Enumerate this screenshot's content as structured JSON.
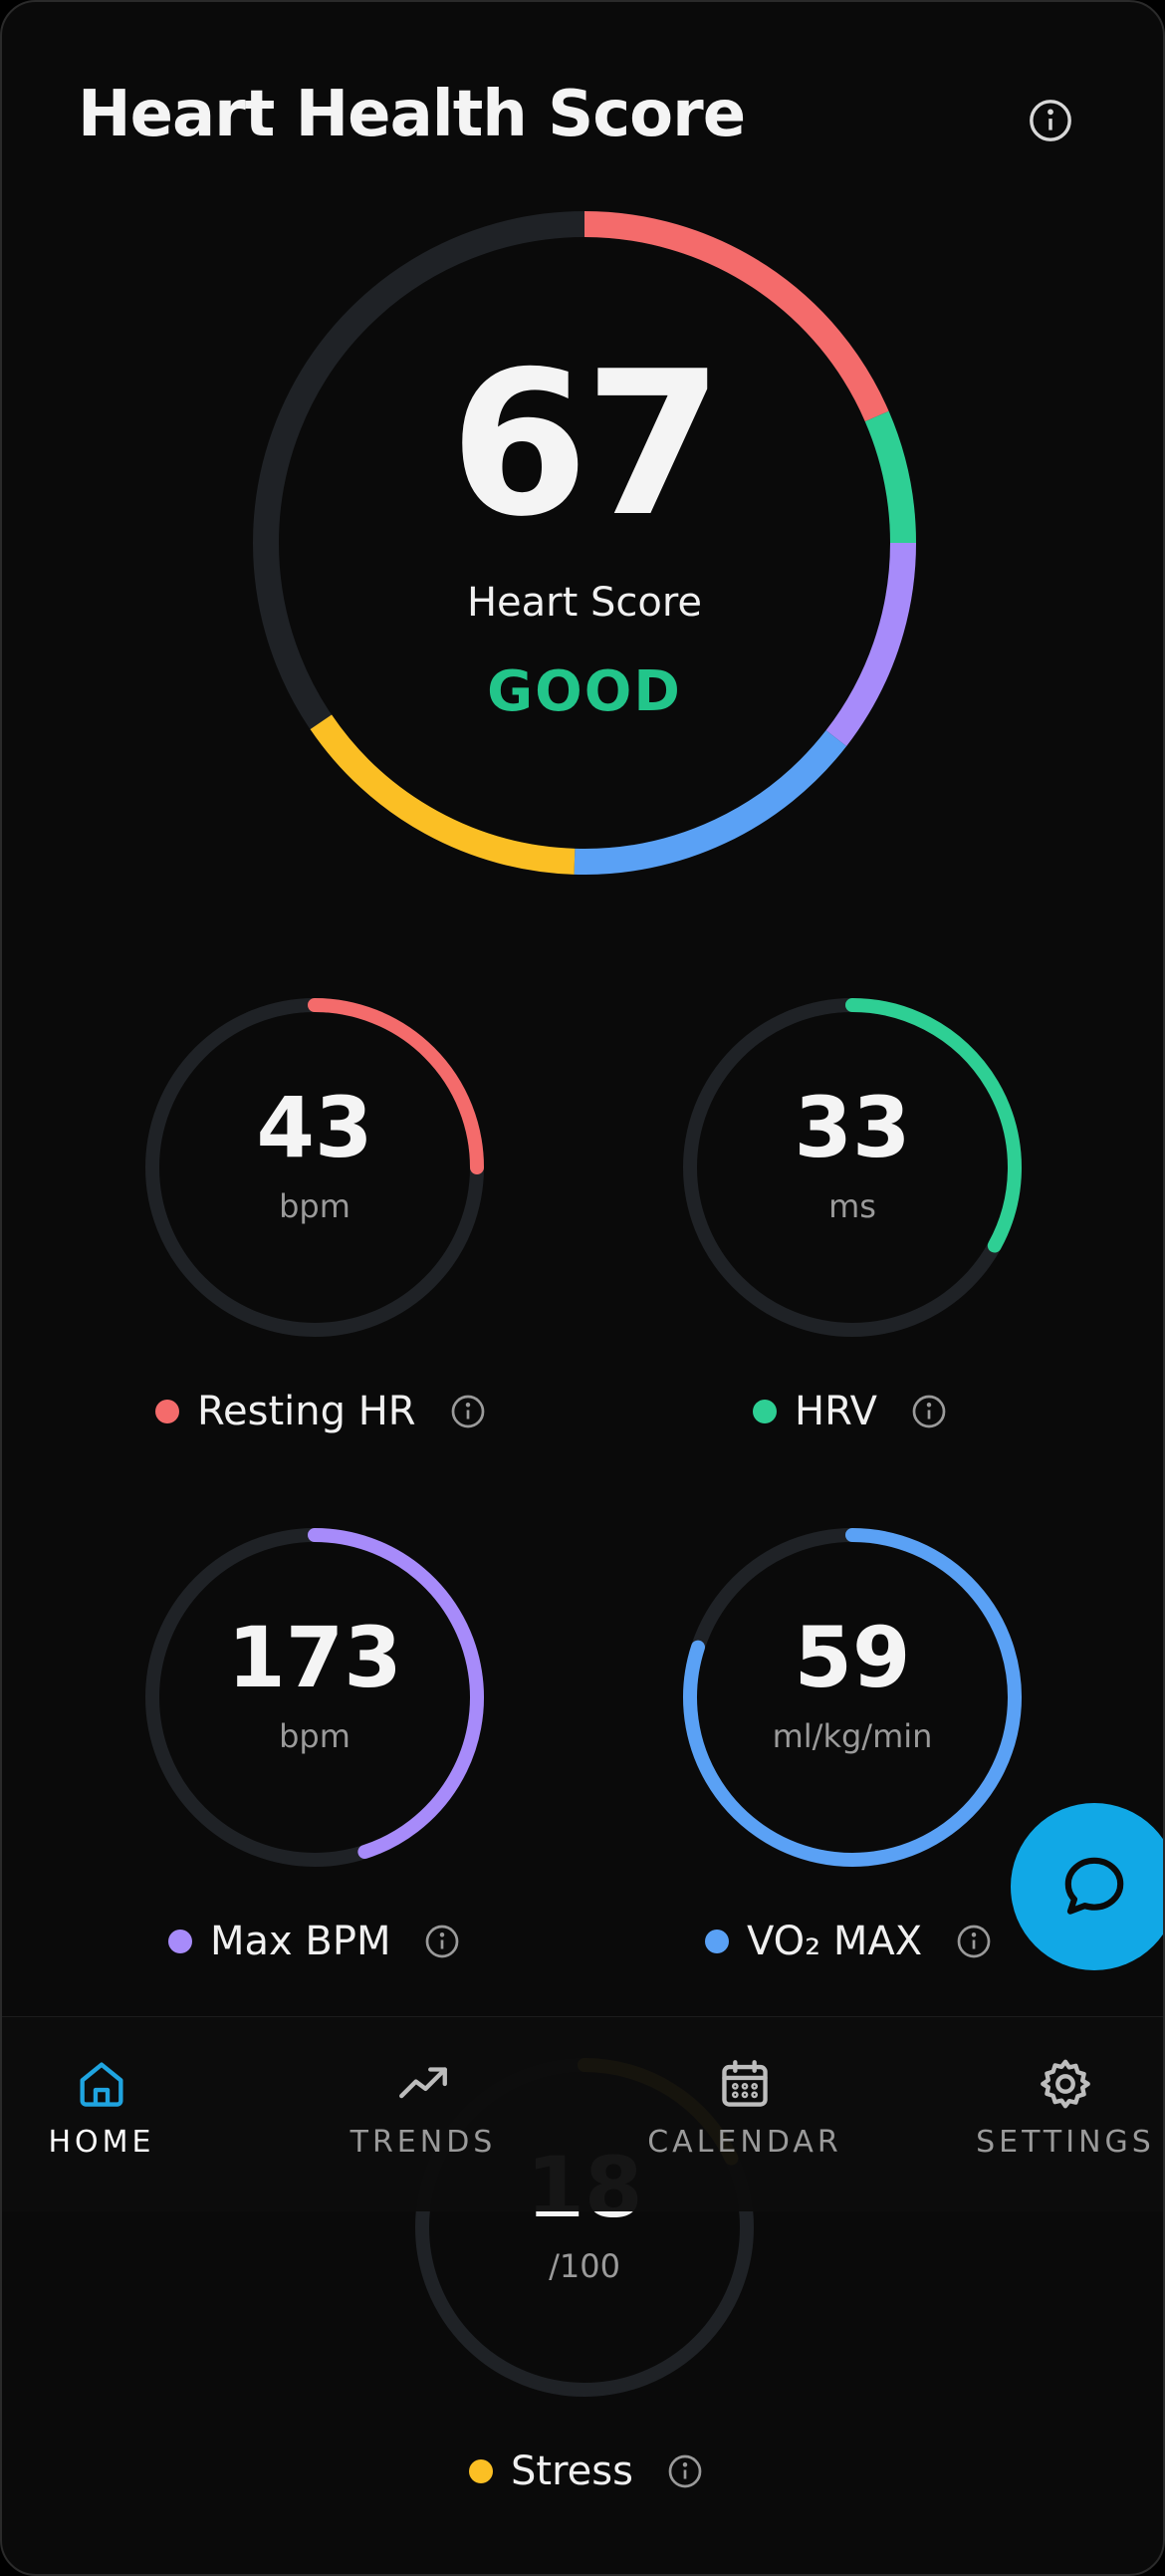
{
  "header": {
    "title": "Heart Health Score",
    "info_icon": "info-icon"
  },
  "score": {
    "value": "67",
    "label": "Heart Score",
    "status": "GOOD",
    "status_color": "#22c58a",
    "max": 100
  },
  "metrics": [
    {
      "id": "resting-hr",
      "value": "43",
      "unit": "bpm",
      "label": "Resting HR",
      "color": "#f46b6b",
      "progress": 0.25
    },
    {
      "id": "hrv",
      "value": "33",
      "unit": "ms",
      "label": "HRV",
      "color": "#2ecf94",
      "progress": 0.33
    },
    {
      "id": "max-bpm",
      "value": "173",
      "unit": "bpm",
      "label": "Max BPM",
      "color": "#a78bfa",
      "progress": 0.45
    },
    {
      "id": "vo2max",
      "value": "59",
      "unit": "ml/kg/min",
      "label": "VO₂ MAX",
      "color": "#5aa1f5",
      "progress": 0.8
    },
    {
      "id": "stress",
      "value": "18",
      "unit": "/100",
      "label": "Stress",
      "color": "#fbbf24",
      "progress": 0.18
    }
  ],
  "fab": {
    "icon": "chat-bubble-icon",
    "color": "#11a8e6"
  },
  "nav": {
    "items": [
      {
        "label": "HOME",
        "icon": "home-icon",
        "active": true
      },
      {
        "label": "TRENDS",
        "icon": "trend-up-icon",
        "active": false
      },
      {
        "label": "CALENDAR",
        "icon": "calendar-icon",
        "active": false
      },
      {
        "label": "SETTINGS",
        "icon": "gear-icon",
        "active": false
      }
    ],
    "active_color": "#1fa4e0"
  },
  "colors": {
    "background": "#0a0a0a",
    "track": "#1f2226"
  }
}
